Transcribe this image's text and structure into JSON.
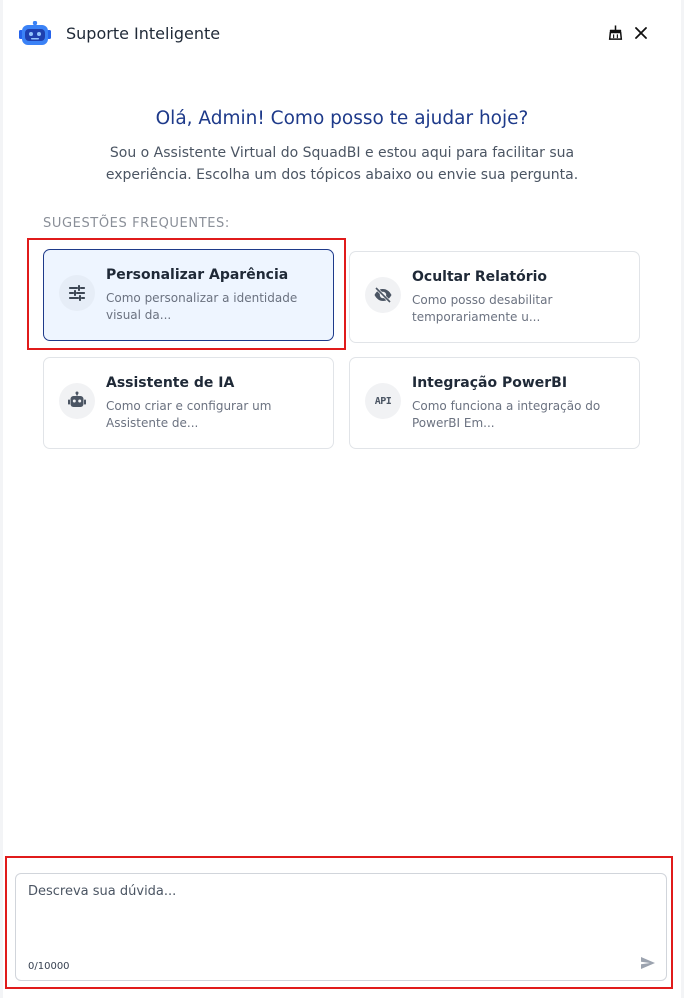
{
  "header": {
    "title": "Suporte Inteligente",
    "logo_icon": "robot-icon",
    "clear_icon": "broom-icon",
    "close_icon": "close-icon"
  },
  "welcome": {
    "greeting": "Olá, Admin! Como posso te ajudar hoje?",
    "intro": "Sou o Assistente Virtual do SquadBI e estou aqui para facilitar sua experiência. Escolha um dos tópicos abaixo ou envie sua pergunta."
  },
  "suggestions": {
    "label": "SUGESTÕES FREQUENTES:",
    "items": [
      {
        "title": "Personalizar Aparência",
        "description": "Como personalizar a identidade visual da...",
        "icon": "tune-icon",
        "active": true
      },
      {
        "title": "Ocultar Relatório",
        "description": "Como posso desabilitar temporariamente u...",
        "icon": "eye-off-icon",
        "active": false
      },
      {
        "title": "Assistente de IA",
        "description": "Como criar e configurar um Assistente de...",
        "icon": "robot-icon",
        "active": false
      },
      {
        "title": "Integração PowerBI",
        "description": "Como funciona a integração do PowerBI Em...",
        "icon": "api-icon",
        "icon_text": "API",
        "active": false
      }
    ]
  },
  "composer": {
    "placeholder": "Descreva sua dúvida...",
    "value": "",
    "counter": "0/10000",
    "send_icon": "send-icon"
  },
  "colors": {
    "accent": "#1e3a8a",
    "active_card_bg": "#eef5ff",
    "highlight": "#e01b1b"
  }
}
